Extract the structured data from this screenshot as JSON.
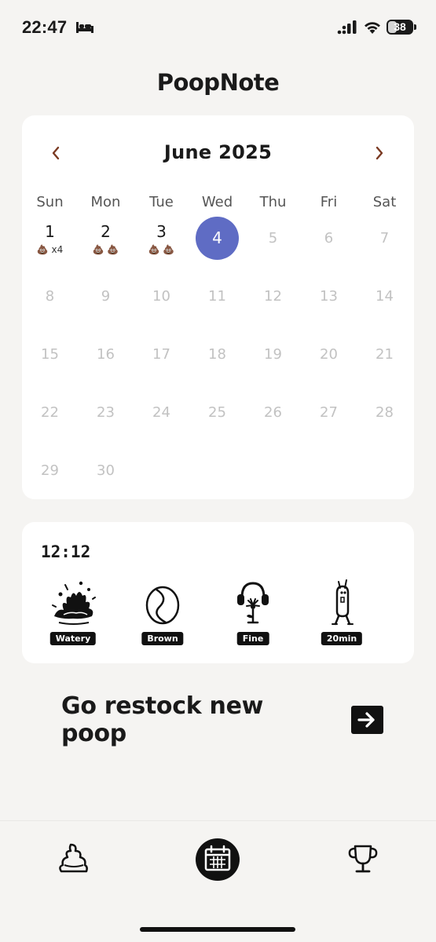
{
  "status_bar": {
    "time": "22:47",
    "sleep_icon": "bed-icon",
    "signal_icon": "cellular-signal-icon",
    "wifi_icon": "wifi-icon",
    "battery_level": "38",
    "battery_fraction": 0.38
  },
  "app": {
    "title": "PoopNote"
  },
  "calendar": {
    "month_label": "June 2025",
    "prev_icon": "chevron-left-icon",
    "next_icon": "chevron-right-icon",
    "accent_color": "#5f6cc4",
    "nav_color": "#7a3a22",
    "weekdays": [
      "Sun",
      "Mon",
      "Tue",
      "Wed",
      "Thu",
      "Fri",
      "Sat"
    ],
    "today": "4",
    "days": [
      {
        "num": "1",
        "marks": "💩 x4"
      },
      {
        "num": "2",
        "marks": "💩 💩"
      },
      {
        "num": "3",
        "marks": "💩 💩"
      },
      {
        "num": "4",
        "marks": ""
      },
      {
        "num": "5",
        "marks": ""
      },
      {
        "num": "6",
        "marks": ""
      },
      {
        "num": "7",
        "marks": ""
      },
      {
        "num": "8",
        "marks": ""
      },
      {
        "num": "9",
        "marks": ""
      },
      {
        "num": "10",
        "marks": ""
      },
      {
        "num": "11",
        "marks": ""
      },
      {
        "num": "12",
        "marks": ""
      },
      {
        "num": "13",
        "marks": ""
      },
      {
        "num": "14",
        "marks": ""
      },
      {
        "num": "15",
        "marks": ""
      },
      {
        "num": "16",
        "marks": ""
      },
      {
        "num": "17",
        "marks": ""
      },
      {
        "num": "18",
        "marks": ""
      },
      {
        "num": "19",
        "marks": ""
      },
      {
        "num": "20",
        "marks": ""
      },
      {
        "num": "21",
        "marks": ""
      },
      {
        "num": "22",
        "marks": ""
      },
      {
        "num": "23",
        "marks": ""
      },
      {
        "num": "24",
        "marks": ""
      },
      {
        "num": "25",
        "marks": ""
      },
      {
        "num": "26",
        "marks": ""
      },
      {
        "num": "27",
        "marks": ""
      },
      {
        "num": "28",
        "marks": ""
      },
      {
        "num": "29",
        "marks": ""
      },
      {
        "num": "30",
        "marks": ""
      }
    ]
  },
  "entry": {
    "time": "12:12",
    "attributes": [
      {
        "label": "Watery",
        "icon": "splash-icon"
      },
      {
        "label": "Brown",
        "icon": "coffee-bean-icon"
      },
      {
        "label": "Fine",
        "icon": "headphones-flower-icon"
      },
      {
        "label": "20min",
        "icon": "standing-figure-icon"
      }
    ]
  },
  "cta": {
    "label": "Go restock new poop",
    "icon": "arrow-right-icon"
  },
  "tab_bar": {
    "tabs": [
      {
        "name": "poop",
        "icon": "poop-icon",
        "active": false
      },
      {
        "name": "calendar",
        "icon": "calendar-icon",
        "active": true
      },
      {
        "name": "trophy",
        "icon": "trophy-icon",
        "active": false
      }
    ]
  }
}
